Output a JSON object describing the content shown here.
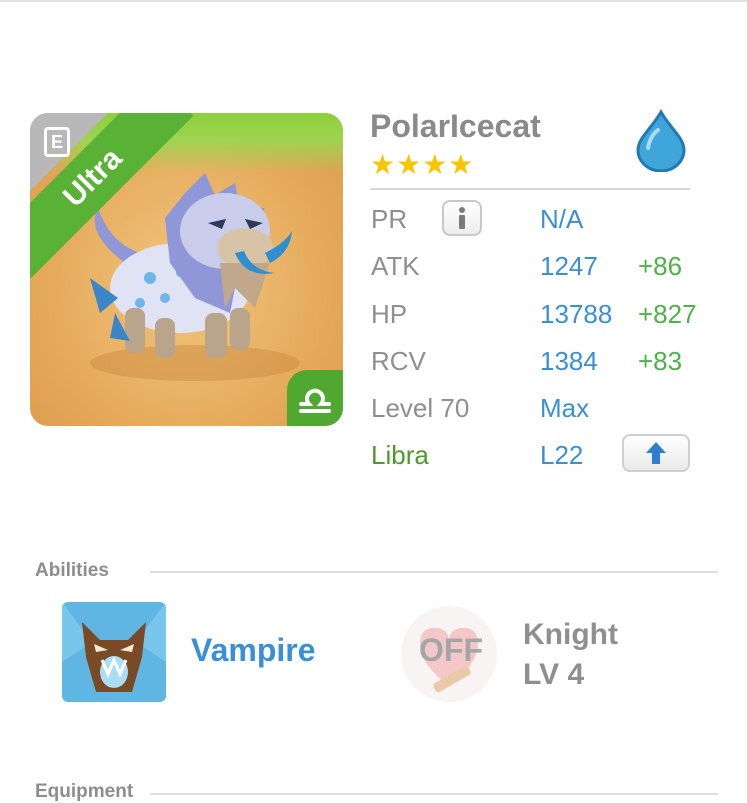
{
  "monster": {
    "name": "PolarIcecat",
    "stars": "★★★★",
    "rank": "Ultra",
    "element_icon": "water-drop-icon",
    "zodiac_icon": "libra-icon"
  },
  "stats": {
    "pr_label": "PR",
    "pr_value": "N/A",
    "atk_label": "ATK",
    "atk_value": "1247",
    "atk_bonus": "+86",
    "hp_label": "HP",
    "hp_value": "13788",
    "hp_bonus": "+827",
    "rcv_label": "RCV",
    "rcv_value": "1384",
    "rcv_bonus": "+83",
    "level_label": "Level 70",
    "level_value": "Max",
    "zodiac_label": "Libra",
    "zodiac_value": "L22"
  },
  "abilities": {
    "title": "Abilities",
    "ability_name": "Vampire",
    "class_status": "OFF",
    "class_name": "Knight",
    "class_level": "LV 4"
  },
  "equipment": {
    "title": "Equipment"
  },
  "colors": {
    "accent_blue": "#3a8fd9",
    "bonus_green": "#4db24a",
    "rank_green": "#59b236",
    "star_gold": "#f7c600"
  }
}
